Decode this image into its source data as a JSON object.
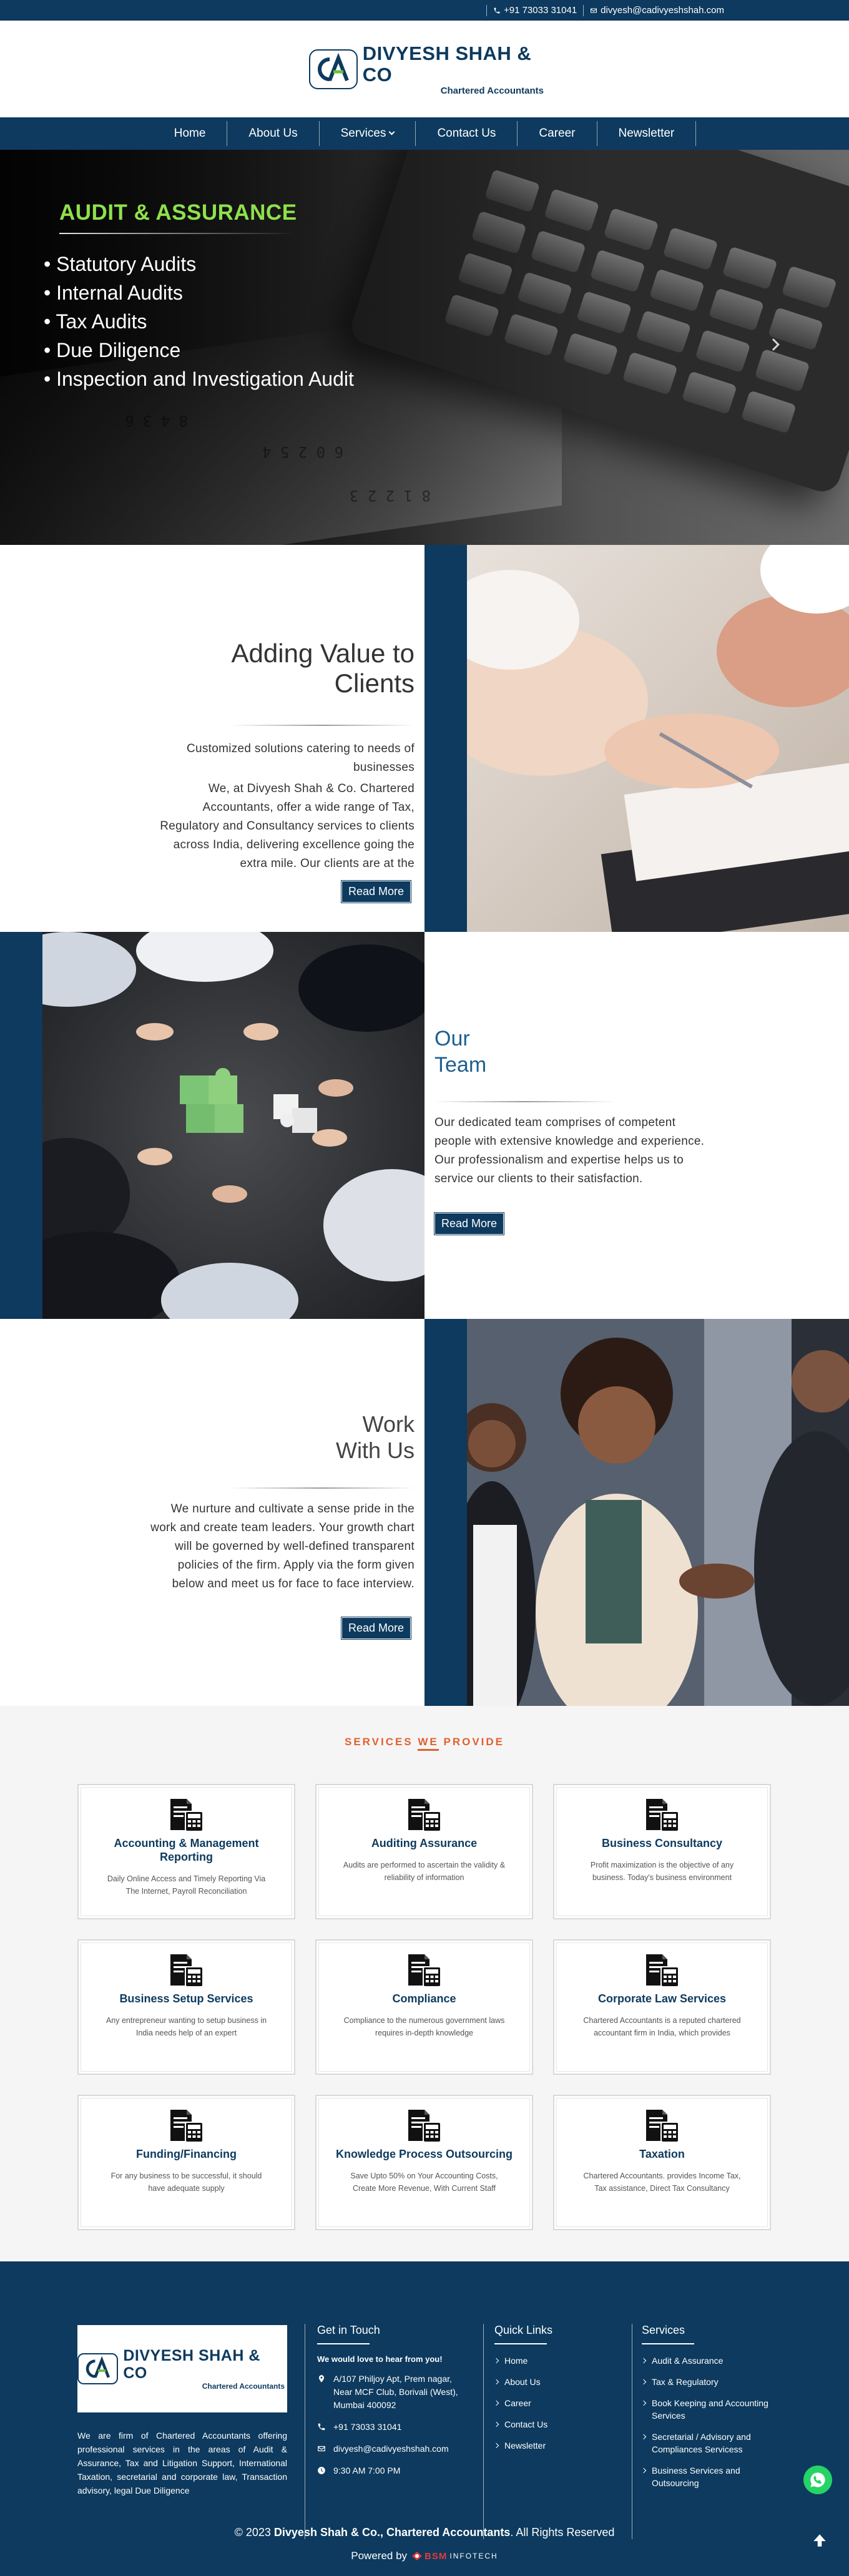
{
  "topbar": {
    "phone": "+91 73033 31041",
    "email": "divyesh@cadivyeshshah.com"
  },
  "brand": {
    "mark": "CA",
    "name": "DIVYESH SHAH & CO",
    "tagline": "Chartered Accountants"
  },
  "nav": {
    "items": [
      "Home",
      "About Us",
      "Services",
      "Contact Us",
      "Career",
      "Newsletter"
    ]
  },
  "hero": {
    "title": "AUDIT & ASSURANCE",
    "bullets": [
      "• Statutory Audits",
      "• Internal Audits",
      "• Tax Audits",
      "• Due Diligence",
      "• Inspection and Investigation Audit"
    ]
  },
  "value_section": {
    "heading_line1": "Adding Value to",
    "heading_line2": "Clients",
    "subheading": "Customized solutions catering to needs of businesses",
    "paragraph": "We, at Divyesh Shah & Co. Chartered Accountants, offer a wide range of Tax, Regulatory and Consultancy services to clients across India, delivering excellence going the extra mile. Our clients are at the",
    "button": "Read More"
  },
  "team_section": {
    "heading_line1": "Our",
    "heading_line2": "Team",
    "paragraph": "Our dedicated team comprises of competent people with extensive knowledge and experience. Our professionalism and expertise helps us to service our clients to their satisfaction.",
    "button": "Read More"
  },
  "work_section": {
    "heading_line1": "Work",
    "heading_line2": "With Us",
    "paragraph": "We nurture and cultivate a sense pride in the work and create team leaders. Your growth chart will be governed by well-defined transparent policies of the firm. Apply via the form given below and meet us for face to face interview.",
    "button": "Read More"
  },
  "services": {
    "heading_pre": "SERVICES ",
    "heading_mid": "WE",
    "heading_post": " PROVIDE",
    "items": [
      {
        "title": "Accounting & Management Reporting",
        "desc": "Daily Online Access and Timely Reporting Via The Internet, Payroll Reconciliation"
      },
      {
        "title": "Auditing Assurance",
        "desc": "Audits are performed to ascertain the validity & reliability of information"
      },
      {
        "title": "Business Consultancy",
        "desc": "Profit maximization is the objective of any business. Today's business environment"
      },
      {
        "title": "Business Setup Services",
        "desc": "Any entrepreneur wanting to setup business in India needs help of an expert"
      },
      {
        "title": "Compliance",
        "desc": "Compliance to the numerous government laws requires in-depth knowledge"
      },
      {
        "title": "Corporate Law Services",
        "desc": "Chartered Accountants is a reputed chartered accountant firm in India, which provides"
      },
      {
        "title": "Funding/Financing",
        "desc": "For any business to be successful, it should have adequate supply"
      },
      {
        "title": "Knowledge Process Outsourcing",
        "desc": "Save Upto 50% on Your Accounting Costs, Create More Revenue, With Current Staff"
      },
      {
        "title": "Taxation",
        "desc": "Chartered Accountants. provides Income Tax, Tax assistance, Direct Tax Consultancy"
      }
    ]
  },
  "footer": {
    "about": "We are firm of Chartered Accountants offering professional services in the areas of Audit & Assurance, Tax and Litigation Support, International Taxation, secretarial and corporate law, Transaction advisory, legal Due Diligence",
    "get_in_touch": {
      "title": "Get in Touch",
      "intro": "We would love to hear from you!",
      "address": "A/107 Philjoy Apt, Prem nagar, Near MCF Club, Borivali (West), Mumbai 400092",
      "phone": "+91 73033 31041",
      "email": "divyesh@cadivyeshshah.com",
      "hours": "9:30 AM 7:00 PM"
    },
    "quick_links": {
      "title": "Quick Links",
      "items": [
        "Home",
        "About Us",
        "Career",
        "Contact Us",
        "Newsletter"
      ]
    },
    "services_links": {
      "title": "Services",
      "items": [
        "Audit & Assurance",
        "Tax & Regulatory",
        "Book Keeping and Accounting Services",
        "Secretarial / Advisory and Compliances Servicess",
        "Business Services and Outsourcing"
      ]
    },
    "copyright_pre": "© 2023 ",
    "copyright_bold": "Divyesh Shah & Co., Chartered Accountants",
    "copyright_post": ". All Rights Reserved",
    "powered_by": "Powered by",
    "powered_brand": "BSM",
    "powered_brand_suffix": "INFOTECH"
  },
  "colors": {
    "primary": "#0d3a5e",
    "accent_green": "#8fe14b",
    "accent_orange": "#e0612f",
    "whatsapp": "#25d366"
  },
  "icons": [
    "phone-icon",
    "mail-icon",
    "chevron-down-icon",
    "chevron-right-icon",
    "calculator-document-icon",
    "location-icon",
    "clock-icon",
    "whatsapp-icon",
    "arrow-up-icon"
  ]
}
